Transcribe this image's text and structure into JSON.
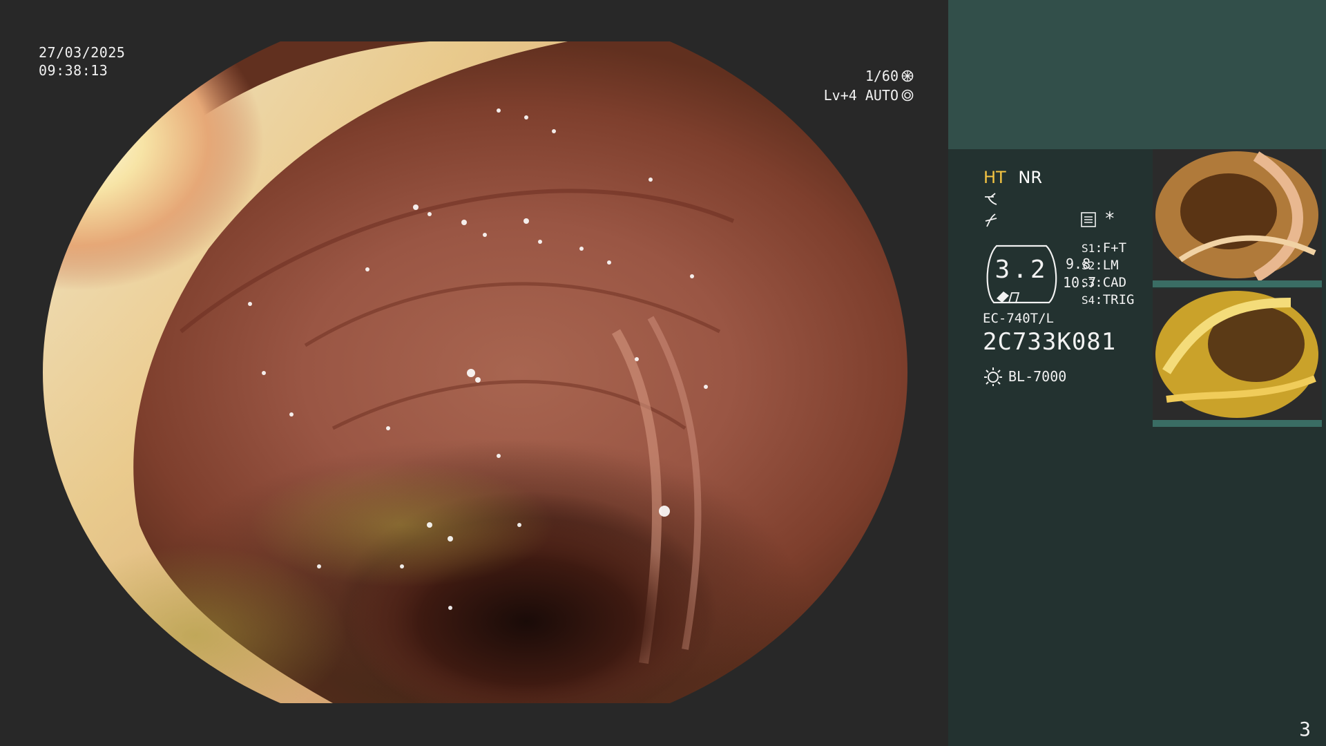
{
  "overlay": {
    "date": "27/03/2025",
    "time": "09:38:13",
    "shutter": "1/60",
    "level": "Lv+4 AUTO"
  },
  "info_panel": {
    "mode_ht": "HT",
    "mode_nr": "NR",
    "magnification": "3.2",
    "param_top": "9.8",
    "param_bottom": "10.7",
    "switches": [
      {
        "key": "S1",
        "value": "F+T"
      },
      {
        "key": "S2",
        "value": "LM"
      },
      {
        "key": "S3",
        "value": "CAD"
      },
      {
        "key": "S4",
        "value": "TRIG"
      }
    ],
    "scope_model": "EC-740T/L",
    "scope_serial": "2C733K081",
    "light_source": "BL-7000",
    "asterisk": "*",
    "page_number": "3"
  },
  "thumbnails": [
    {
      "name": "capture 1",
      "index": "2"
    },
    {
      "name": "capture 2",
      "index": "1"
    }
  ],
  "colors": {
    "panel_bg": "#233230",
    "panel_top": "#324f4a",
    "accent_ht": "#f5c542",
    "screen_bg": "#282828"
  },
  "icons": [
    "shutter-icon",
    "auto-iris-icon",
    "structure-enhance-icon",
    "color-enhance-icon",
    "menu-icon",
    "scope-badge-icon",
    "light-source-icon"
  ]
}
